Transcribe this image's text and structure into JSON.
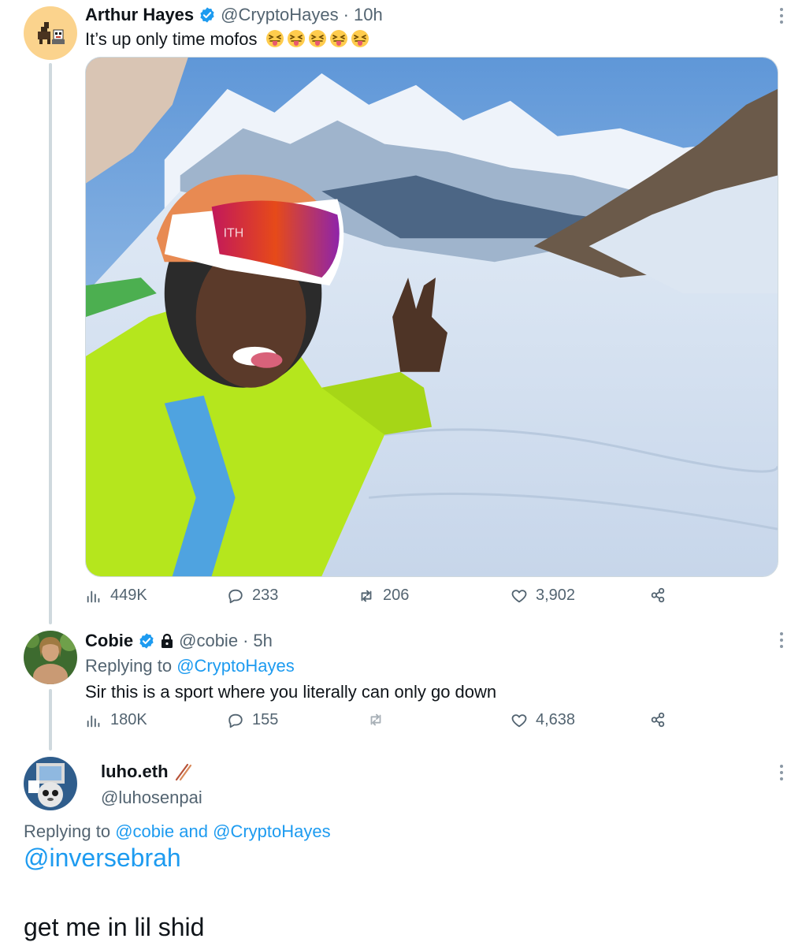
{
  "tweets": [
    {
      "name": "Arthur Hayes",
      "handle": "@CryptoHayes",
      "separator": "·",
      "time": "10h",
      "text": "It’s up only time mofos",
      "emoji": "squinting-face-with-tongue",
      "emoji_count": 5,
      "verified": true,
      "stats": {
        "views": "449K",
        "replies": "233",
        "retweets": "206",
        "likes": "3,902"
      }
    },
    {
      "name": "Cobie",
      "handle": "@cobie",
      "separator": "·",
      "time": "5h",
      "verified": true,
      "protected": true,
      "replying_prefix": "Replying to",
      "replying_link": "@CryptoHayes",
      "text": "Sir this is a sport where you literally can only go down",
      "stats": {
        "views": "180K",
        "replies": "155",
        "retweets": "",
        "likes": "4,638"
      }
    },
    {
      "name": "luho.eth",
      "name_icon": "chopsticks-icon",
      "handle": "@luhosenpai",
      "replying_prefix": "Replying to",
      "replying_link_1": "@cobie",
      "replying_and": "and",
      "replying_link_2": "@CryptoHayes",
      "mention": "@inversebrah",
      "text": "get me in lil shid"
    }
  ],
  "colors": {
    "accent": "#1d9bf0",
    "text_primary": "#0f1419",
    "text_secondary": "#536471",
    "thread_line": "#cfd9de",
    "jacket": "#b5e61d"
  }
}
